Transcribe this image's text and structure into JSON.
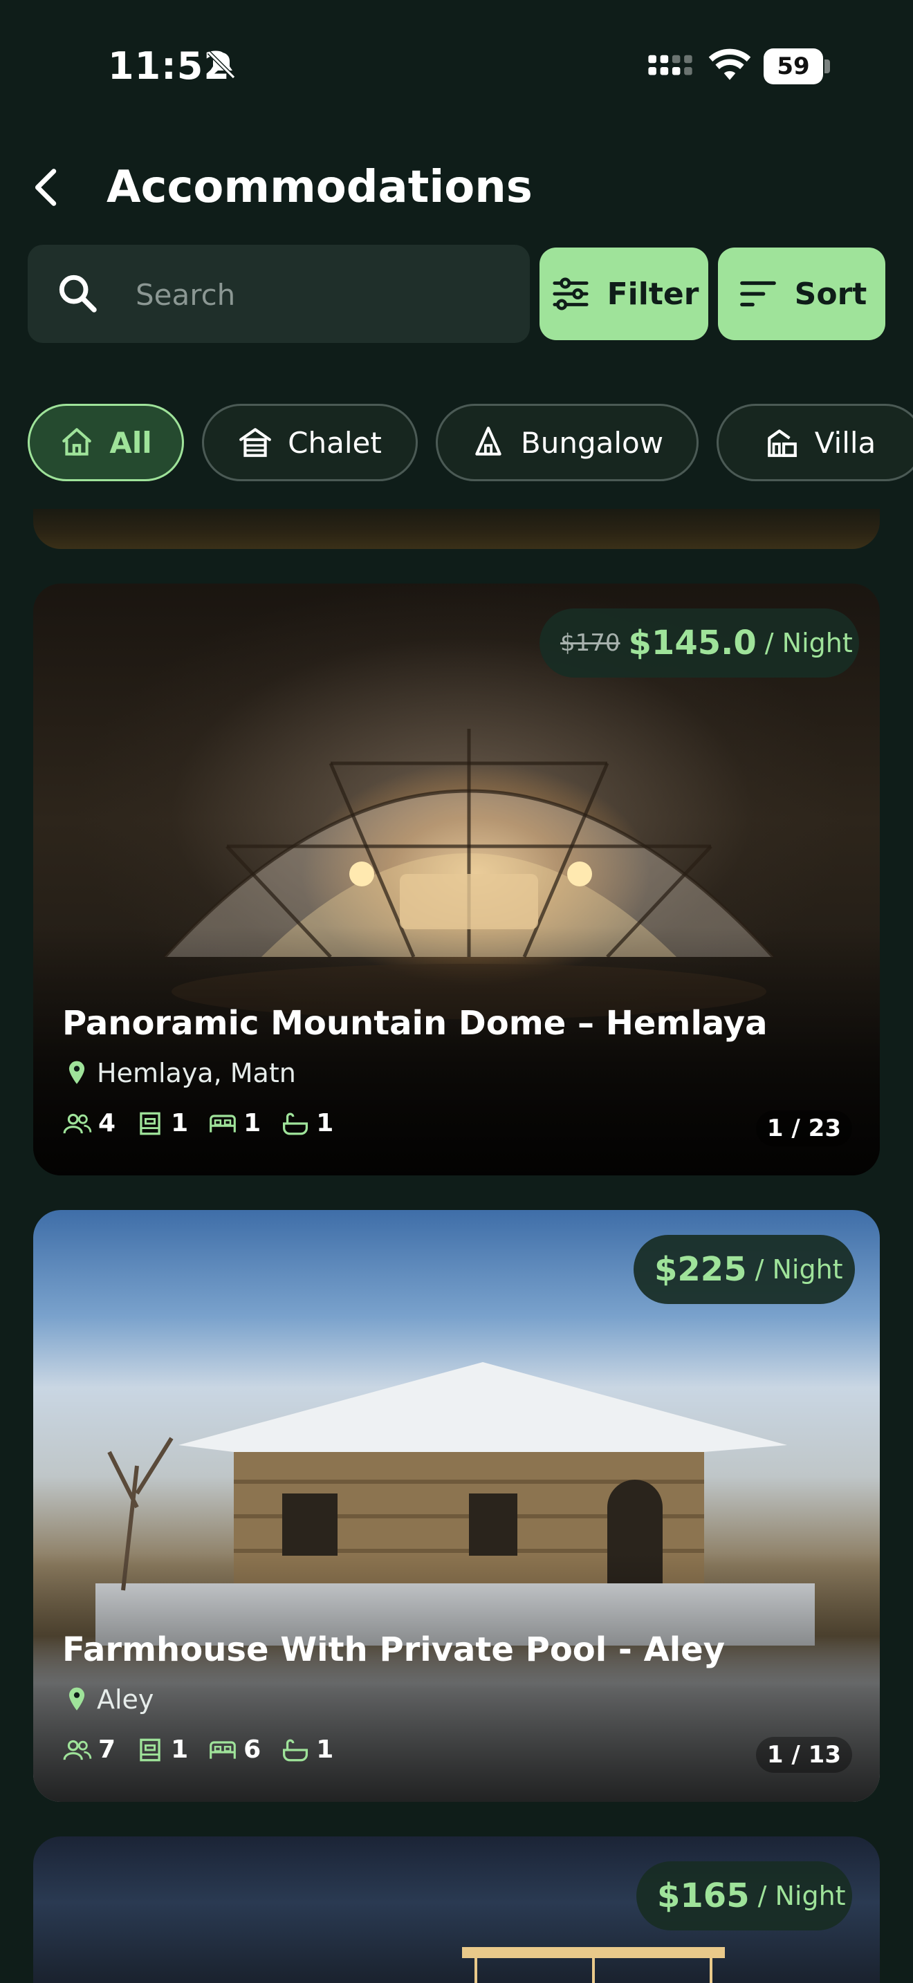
{
  "status": {
    "time": "11:52",
    "battery": "59"
  },
  "header": {
    "title": "Accommodations"
  },
  "search": {
    "placeholder": "Search"
  },
  "actions": {
    "filter_label": "Filter",
    "sort_label": "Sort"
  },
  "categories": [
    {
      "label": "All",
      "icon": "home-icon",
      "active": true
    },
    {
      "label": "Chalet",
      "icon": "chalet-icon",
      "active": false
    },
    {
      "label": "Bungalow",
      "icon": "bungalow-icon",
      "active": false
    },
    {
      "label": "Villa",
      "icon": "villa-icon",
      "active": false
    }
  ],
  "listings": [
    {
      "old_price": "$170",
      "price": "$145.0",
      "per": "/ Night",
      "title": "Panoramic Mountain Dome – Hemlaya",
      "location": "Hemlaya, Matn",
      "guests": "4",
      "rooms": "1",
      "beds": "1",
      "baths": "1",
      "counter": "1 / 23"
    },
    {
      "price": "$225",
      "per": "/ Night",
      "title": "Farmhouse With Private Pool - Aley",
      "location": "Aley",
      "guests": "7",
      "rooms": "1",
      "beds": "6",
      "baths": "1",
      "counter": "1 / 13"
    },
    {
      "price": "$165",
      "per": "/ Night"
    }
  ],
  "colors": {
    "background": "#0f1d19",
    "accent": "#9fe39a",
    "surface": "#1f2f2a"
  }
}
